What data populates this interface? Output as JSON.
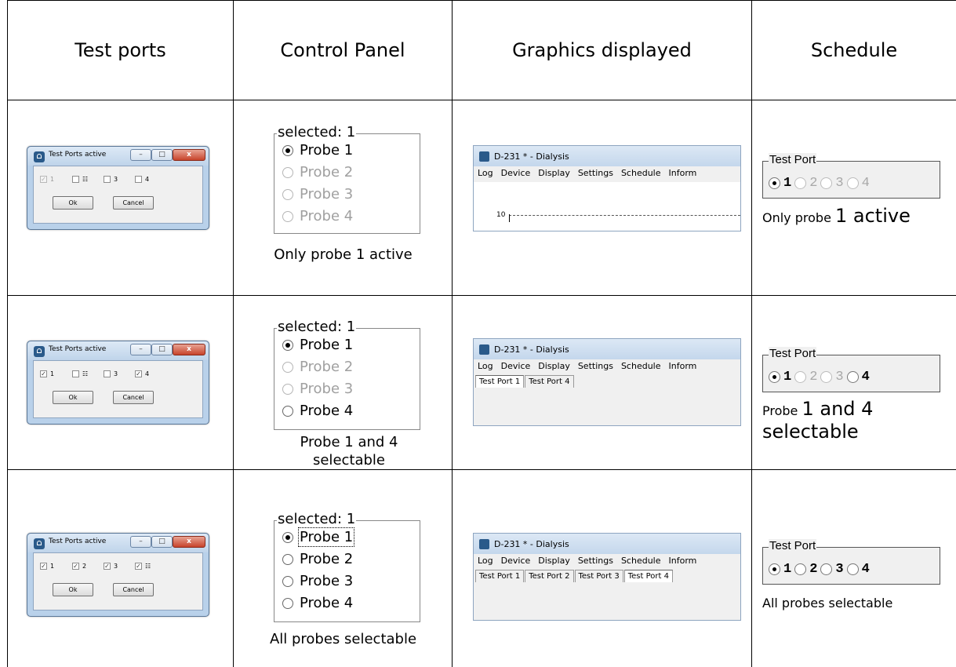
{
  "headers": [
    "Test ports",
    "Control Panel",
    "Graphics displayed",
    "Schedule"
  ],
  "dialog": {
    "title": "Test Ports active",
    "min": "–",
    "max": "□",
    "close": "x",
    "ok": "Ok",
    "cancel": "Cancel",
    "labels": [
      "1",
      "2",
      "3",
      "4"
    ]
  },
  "rows": [
    {
      "dialog_checked": [
        "✓",
        "",
        "",
        ""
      ],
      "dialog_label2": "☷",
      "dialog_label4": "4",
      "control": {
        "legend": "selected: 1",
        "probes": [
          "Probe 1",
          "Probe 2",
          "Probe 3",
          "Probe 4"
        ],
        "caption": "Only probe 1 active"
      },
      "graphics": {
        "title": "D-231 * - Dialysis",
        "menu": [
          "Log",
          "Device",
          "Display",
          "Settings",
          "Schedule",
          "Inform"
        ],
        "tick": "10"
      },
      "schedule": {
        "legend": "Test Port",
        "options": [
          "1",
          "2",
          "3",
          "4"
        ],
        "caption_pre": "Only probe ",
        "caption_big": "1 active",
        "caption_post": ""
      }
    },
    {
      "dialog_checked": [
        "✓",
        "",
        "",
        "✓"
      ],
      "dialog_label2": "☷",
      "dialog_label4": "4",
      "control": {
        "legend": "selected: 1",
        "probes": [
          "Probe 1",
          "Probe 2",
          "Probe 3",
          "Probe 4"
        ],
        "caption": "Probe 1 and 4 selectable"
      },
      "graphics": {
        "title": "D-231 * - Dialysis",
        "menu": [
          "Log",
          "Device",
          "Display",
          "Settings",
          "Schedule",
          "Inform"
        ],
        "tabs": [
          "Test Port 1",
          "Test Port 4"
        ]
      },
      "schedule": {
        "legend": "Test Port",
        "options": [
          "1",
          "2",
          "3",
          "4"
        ],
        "caption_pre": "Probe ",
        "caption_big": "1 and 4",
        "caption_post": "selectable"
      }
    },
    {
      "dialog_checked": [
        "✓",
        "✓",
        "✓",
        "✓"
      ],
      "dialog_label2": "2",
      "dialog_label4": "☷",
      "control": {
        "legend": "selected: 1",
        "probes": [
          "Probe 1",
          "Probe 2",
          "Probe 3",
          "Probe 4"
        ],
        "caption": "All probes selectable"
      },
      "graphics": {
        "title": "D-231 * - Dialysis",
        "menu": [
          "Log",
          "Device",
          "Display",
          "Settings",
          "Schedule",
          "Inform"
        ],
        "tabs": [
          "Test Port 1",
          "Test Port 2",
          "Test Port 3",
          "Test Port 4"
        ]
      },
      "schedule": {
        "legend": "Test Port",
        "options": [
          "1",
          "2",
          "3",
          "4"
        ],
        "caption": "All probes selectable"
      }
    }
  ]
}
